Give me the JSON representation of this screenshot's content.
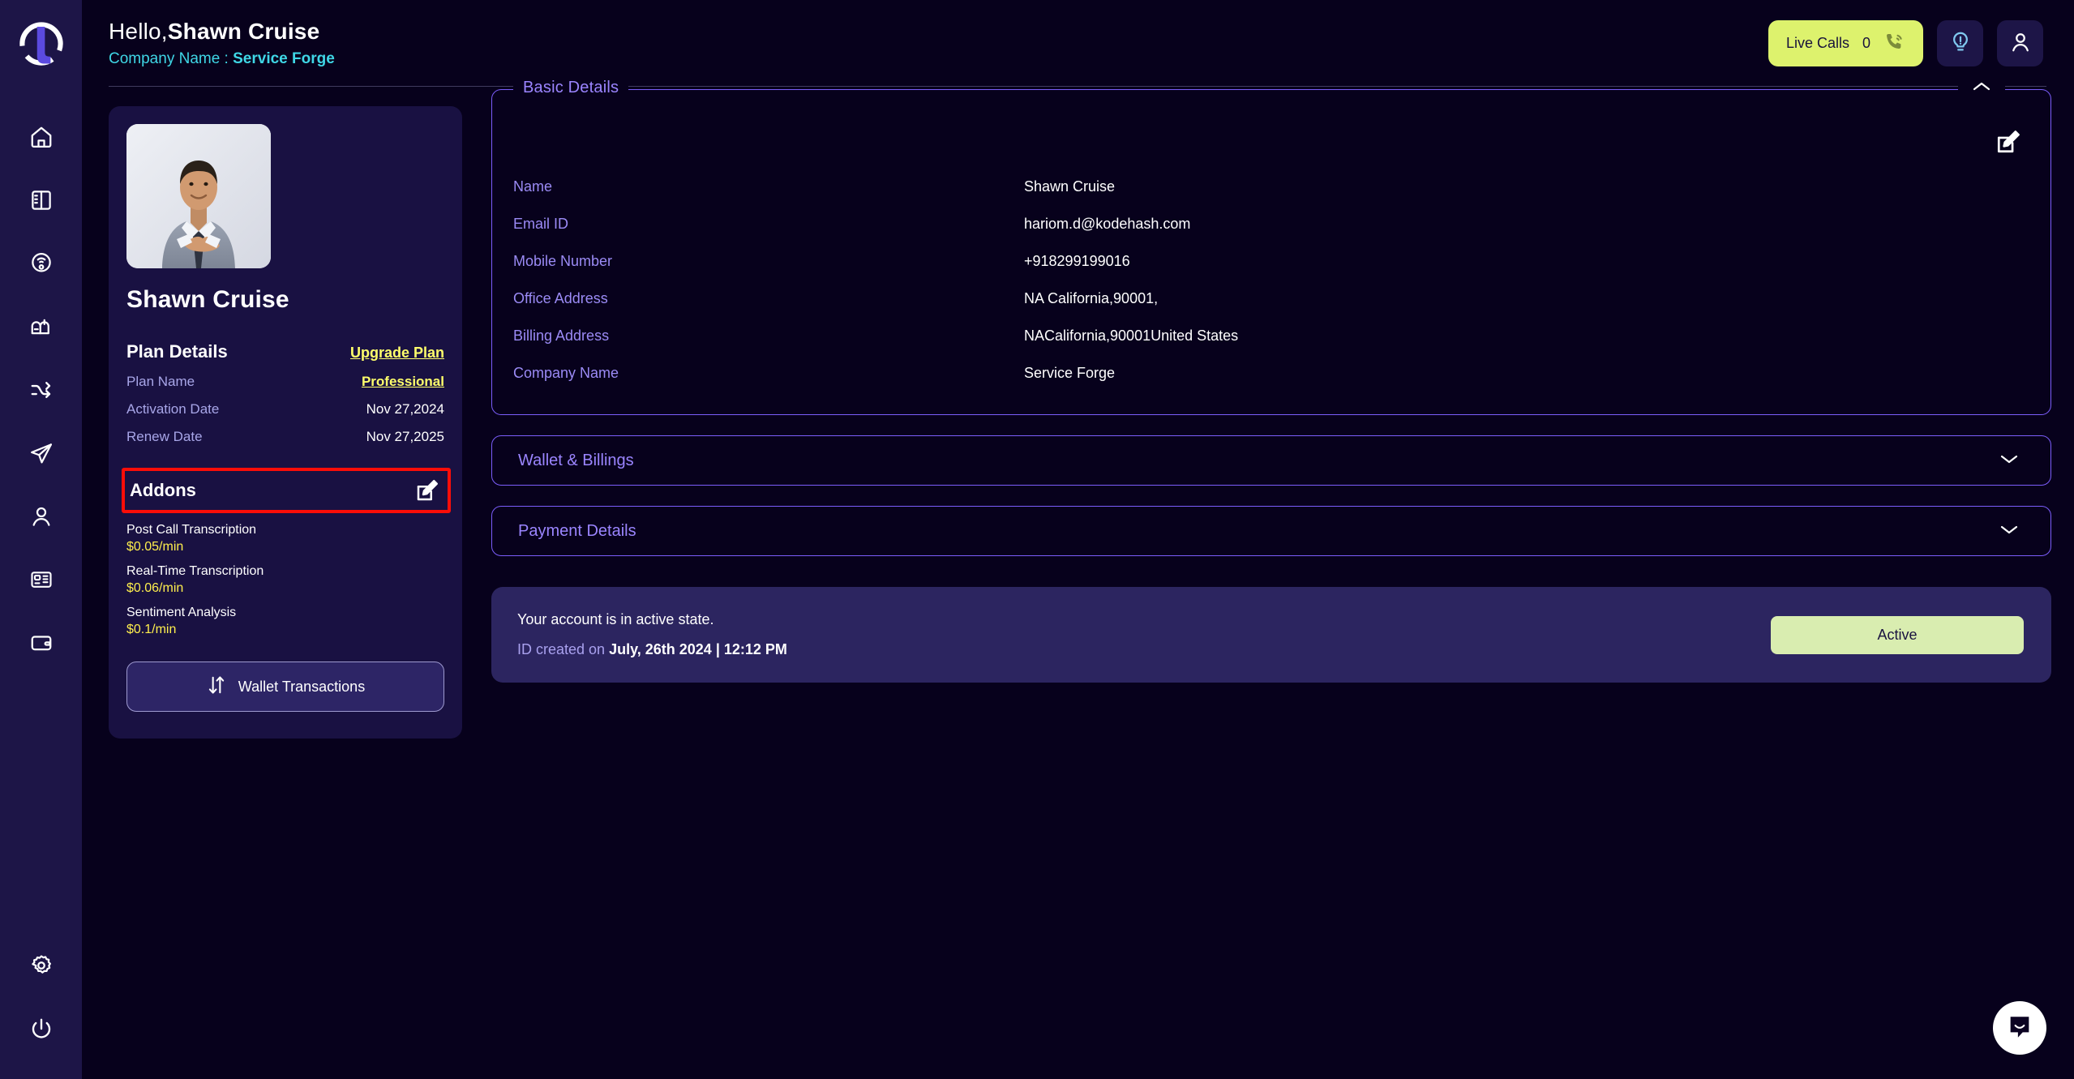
{
  "app": {
    "logo_name": "brand-logo",
    "accent_lime": "#ddf26d",
    "accent_purple": "#7b5dfa",
    "accent_cyan": "#3fd7e6",
    "accent_yellow": "#ffff6b",
    "annotation_red": "#fb0d08"
  },
  "sidebar": {
    "top_items": [
      {
        "name": "home",
        "label": "Home"
      },
      {
        "name": "dashboard",
        "label": "Dashboard"
      },
      {
        "name": "broadcast",
        "label": "Broadcast"
      },
      {
        "name": "mailbox",
        "label": "Mailbox"
      },
      {
        "name": "routing",
        "label": "Routing"
      },
      {
        "name": "campaigns",
        "label": "Campaigns"
      },
      {
        "name": "contacts",
        "label": "Contacts"
      },
      {
        "name": "phone-system",
        "label": "Phone System"
      },
      {
        "name": "wallet",
        "label": "Wallet"
      }
    ],
    "bottom_items": [
      {
        "name": "settings",
        "label": "Settings"
      },
      {
        "name": "logout",
        "label": "Logout"
      }
    ]
  },
  "header": {
    "greeting_prefix": "Hello,",
    "user_name": "Shawn Cruise",
    "company_label": "Company Name :",
    "company_name": "Service Forge",
    "live_calls_label": "Live Calls",
    "live_calls_count": "0",
    "help_icon": "info-bulb-icon",
    "account_icon": "user-icon"
  },
  "profile": {
    "avatar_alt": "Shawn Cruise profile photo",
    "name": "Shawn Cruise",
    "plan": {
      "title": "Plan Details",
      "upgrade_label": "Upgrade Plan",
      "rows": [
        {
          "label": "Plan Name",
          "value": "Professional",
          "accent": true
        },
        {
          "label": "Activation Date",
          "value": "Nov 27,2024",
          "accent": false
        },
        {
          "label": "Renew Date",
          "value": "Nov 27,2025",
          "accent": false
        }
      ]
    },
    "addons": {
      "title": "Addons",
      "edit_icon": "edit-square-icon",
      "items": [
        {
          "name": "Post Call Transcription",
          "price": "$0.05/min"
        },
        {
          "name": "Real-Time Transcription",
          "price": "$0.06/min"
        },
        {
          "name": "Sentiment Analysis",
          "price": "$0.1/min"
        }
      ]
    },
    "wallet_button_label": "Wallet Transactions"
  },
  "basic_details": {
    "legend": "Basic Details",
    "edit_icon": "edit-square-icon",
    "collapse_icon": "chevron-up-icon",
    "rows": [
      {
        "label": "Name",
        "value": "Shawn Cruise"
      },
      {
        "label": "Email ID",
        "value": "hariom.d@kodehash.com"
      },
      {
        "label": "Mobile Number",
        "value": "+918299199016"
      },
      {
        "label": "Office Address",
        "value": "NA California,90001,"
      },
      {
        "label": "Billing Address",
        "value": "NACalifornia,90001United States"
      },
      {
        "label": "Company Name",
        "value": "Service Forge"
      }
    ]
  },
  "collapsed_panels": [
    {
      "title": "Wallet & Billings",
      "icon": "chevron-down-icon"
    },
    {
      "title": "Payment Details",
      "icon": "chevron-down-icon"
    }
  ],
  "status": {
    "message": "Your account is in active state.",
    "created_label": "ID created on",
    "created_value": "July, 26th 2024 | 12:12 PM",
    "badge_label": "Active"
  },
  "chat": {
    "icon": "chat-bubble-icon"
  }
}
